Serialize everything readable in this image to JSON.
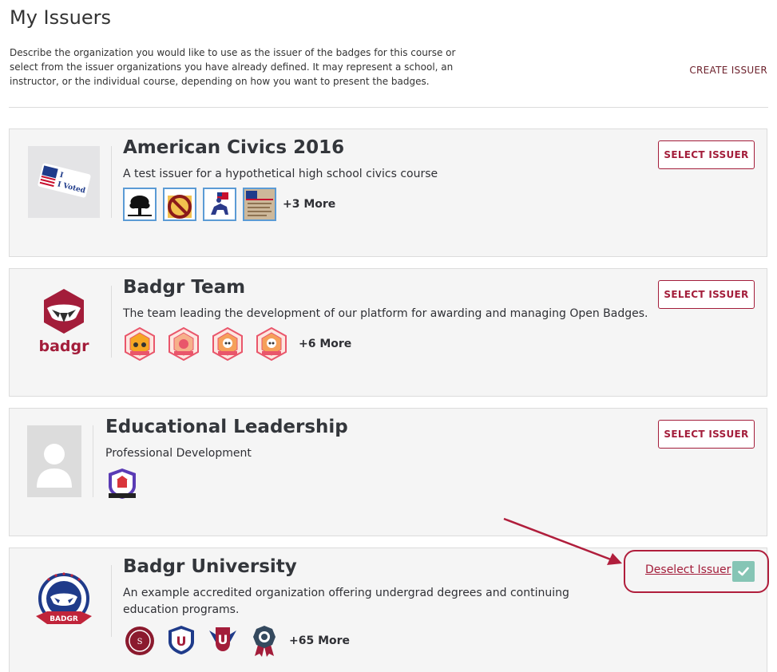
{
  "header": {
    "title": "My Issuers",
    "intro": "Describe the organization you would like to use as the issuer of the badges for this course or select from the issuer organizations you have already defined. It may represent a school, an instructor, or the individual course, depending on how you want to present the badges.",
    "create_label": "CREATE ISSUER"
  },
  "issuers": [
    {
      "name": "American Civics 2016",
      "description": "A test issuer for a hypothetical high school civics course",
      "more": "+3 More",
      "action_label": "SELECT ISSUER",
      "logo_text": "I Voted",
      "badges": [
        "tree-badge-icon",
        "no-symbol-badge-icon",
        "horse-rider-badge-icon",
        "document-badge-icon"
      ]
    },
    {
      "name": "Badgr Team",
      "description": "The team leading the development of our platform for awarding and managing Open Badges.",
      "more": "+6 More",
      "action_label": "SELECT ISSUER",
      "logo_text": "badgr",
      "badges": [
        "badgr-scout-badge-icon",
        "badgr-explorer-badge-icon",
        "badgr-skull-badge-icon",
        "badgr-skull-badge-icon"
      ]
    },
    {
      "name": "Educational Leadership",
      "description": "Professional Development",
      "more": "",
      "action_label": "SELECT ISSUER",
      "badges": [
        "classroom-badge-icon"
      ]
    },
    {
      "name": "Badgr University",
      "description": "An example accredited organization offering undergrad degrees and continuing education programs.",
      "more": "+65 More",
      "action_label": "Deselect Issuer",
      "logo_text": "BADGR",
      "badges": [
        "seal-badge-icon",
        "u-shield-badge-icon",
        "u-winged-badge-icon",
        "ribbon-badge-icon"
      ]
    }
  ],
  "colors": {
    "accent": "#a31d3a",
    "card_bg": "#f5f5f5",
    "check": "#86c5b5"
  }
}
